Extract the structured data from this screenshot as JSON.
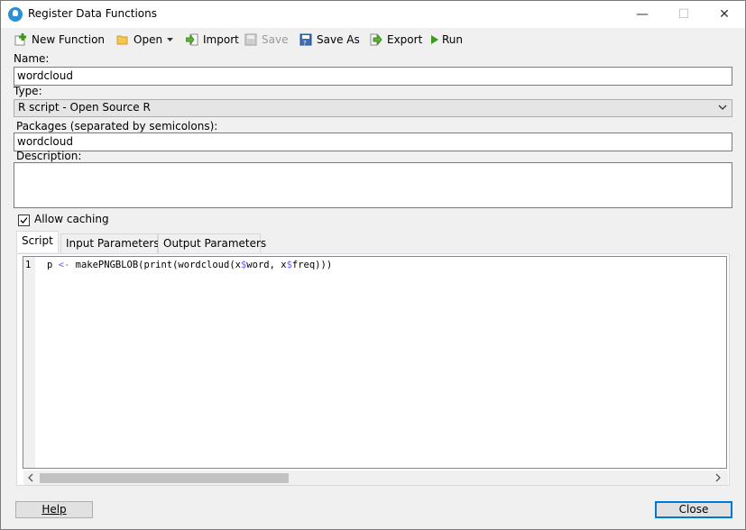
{
  "window": {
    "title": "Register Data Functions",
    "controls": {
      "minimize": "—",
      "maximize": "☐",
      "close": "✕"
    }
  },
  "toolbar": {
    "new_function": "New Function",
    "open": "Open",
    "import": "Import",
    "save": "Save",
    "save_as": "Save As",
    "export": "Export",
    "run": "Run"
  },
  "form": {
    "name_label": "Name:",
    "name_value": "wordcloud",
    "type_label": "Type:",
    "type_value": "R script - Open Source R",
    "packages_label": "Packages (separated by semicolons):",
    "packages_value": "wordcloud",
    "description_label": "Description:",
    "description_value": "",
    "allow_caching_label": "Allow caching",
    "allow_caching_checked": true
  },
  "tabs": [
    {
      "label": "Script",
      "active": true
    },
    {
      "label": "Input Parameters",
      "active": false
    },
    {
      "label": "Output Parameters",
      "active": false
    }
  ],
  "editor": {
    "line_numbers": [
      "1"
    ],
    "lines": [
      {
        "p1": "p ",
        "op1": "<-",
        "p2": " makePNGBLOB(print(wordcloud(x",
        "op2": "$",
        "p3": "word, x",
        "op3": "$",
        "p4": "freq)))"
      }
    ]
  },
  "footer": {
    "help": "Help",
    "close": "Close"
  },
  "colors": {
    "accent": "#0078d7",
    "window_bg": "#f0f0f0",
    "operator": "#6464ff"
  }
}
